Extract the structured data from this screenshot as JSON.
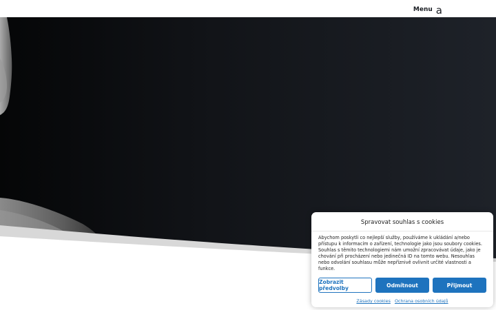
{
  "header": {
    "menu_label": "Menu",
    "menu_icon_glyph": "a"
  },
  "hero": {
    "background_color": "#1b1e24"
  },
  "cookie_dialog": {
    "title": "Spravovat souhlas s cookies",
    "text": "Abychom poskytli co nejlepší služby, používáme k ukládání a/nebo přístupu k informacím o zařízení, technologie jako jsou soubory cookies. Souhlas s těmito technologiemi nám umožní zpracovávat údaje, jako je chování při procházení nebo jedinečná ID na tomto webu. Nesouhlas nebo odvolání souhlasu může nepříznivě ovlivnit určité vlastnosti a funkce.",
    "buttons": {
      "preferences": "Zobrazit předvolby",
      "deny": "Odmítnout",
      "accept": "Přijmout"
    },
    "links": {
      "cookie_policy": "Zásady cookies",
      "privacy": "Ochrana osobních údajů"
    },
    "accent_color": "#1e73be"
  }
}
